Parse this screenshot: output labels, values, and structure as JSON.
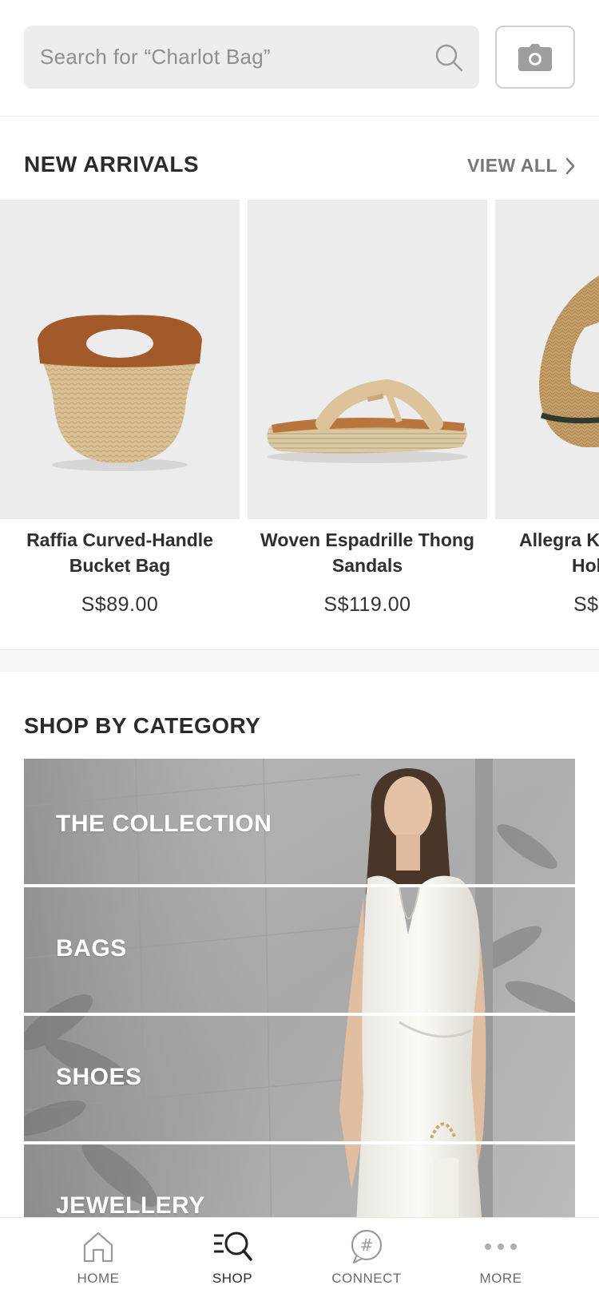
{
  "search": {
    "placeholder": "Search for “Charlot Bag”",
    "icon": "search-icon",
    "camera_icon": "camera-icon"
  },
  "new_arrivals": {
    "title": "NEW ARRIVALS",
    "view_all": "VIEW ALL",
    "products": [
      {
        "name_line1": "Raffia Curved-Handle",
        "name_line2": "Bucket Bag",
        "price": "S$89.00"
      },
      {
        "name_line1": "Woven Espadrille Thong",
        "name_line2": "Sandals",
        "price": "S$119.00"
      },
      {
        "name_line1": "Allegra Kn",
        "name_line2": "Hol",
        "price": "S$"
      }
    ]
  },
  "categories": {
    "title": "SHOP BY CATEGORY",
    "items": [
      {
        "label": "THE COLLECTION"
      },
      {
        "label": "BAGS"
      },
      {
        "label": "SHOES"
      },
      {
        "label": "JEWELLERY"
      }
    ]
  },
  "bottom_nav": {
    "items": [
      {
        "label": "HOME",
        "icon": "home-icon"
      },
      {
        "label": "SHOP",
        "icon": "shop-search-icon",
        "active": true
      },
      {
        "label": "CONNECT",
        "icon": "hashtag-icon"
      },
      {
        "label": "MORE",
        "icon": "more-dots-icon"
      }
    ]
  },
  "colors": {
    "background": "#ffffff",
    "search_bg": "#ededed",
    "card_bg": "#ececec",
    "text_primary": "#2b2b2b",
    "text_muted": "#777777"
  }
}
